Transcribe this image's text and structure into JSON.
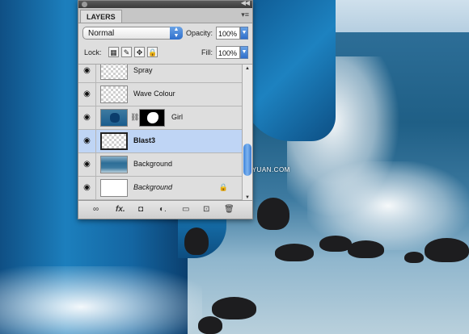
{
  "panel": {
    "tab_label": "LAYERS",
    "blend_mode": "Normal",
    "opacity_label": "Opacity:",
    "opacity_value": "100%",
    "lock_label": "Lock:",
    "fill_label": "Fill:",
    "fill_value": "100%"
  },
  "layers": [
    {
      "name": "Spray",
      "visible": true,
      "selected": false
    },
    {
      "name": "Wave Colour",
      "visible": true,
      "selected": false
    },
    {
      "name": "Girl",
      "visible": true,
      "selected": false,
      "has_mask": true
    },
    {
      "name": "Blast3",
      "visible": true,
      "selected": true
    },
    {
      "name": "Background",
      "visible": true,
      "selected": false
    },
    {
      "name": "Background",
      "visible": true,
      "selected": false,
      "locked": true
    }
  ],
  "watermark": "思缘设计论坛 WWW.MISSYUAN.COM",
  "colors": {
    "selected_layer": "#bfd5f5",
    "accent_blue": "#2f6fcc"
  }
}
